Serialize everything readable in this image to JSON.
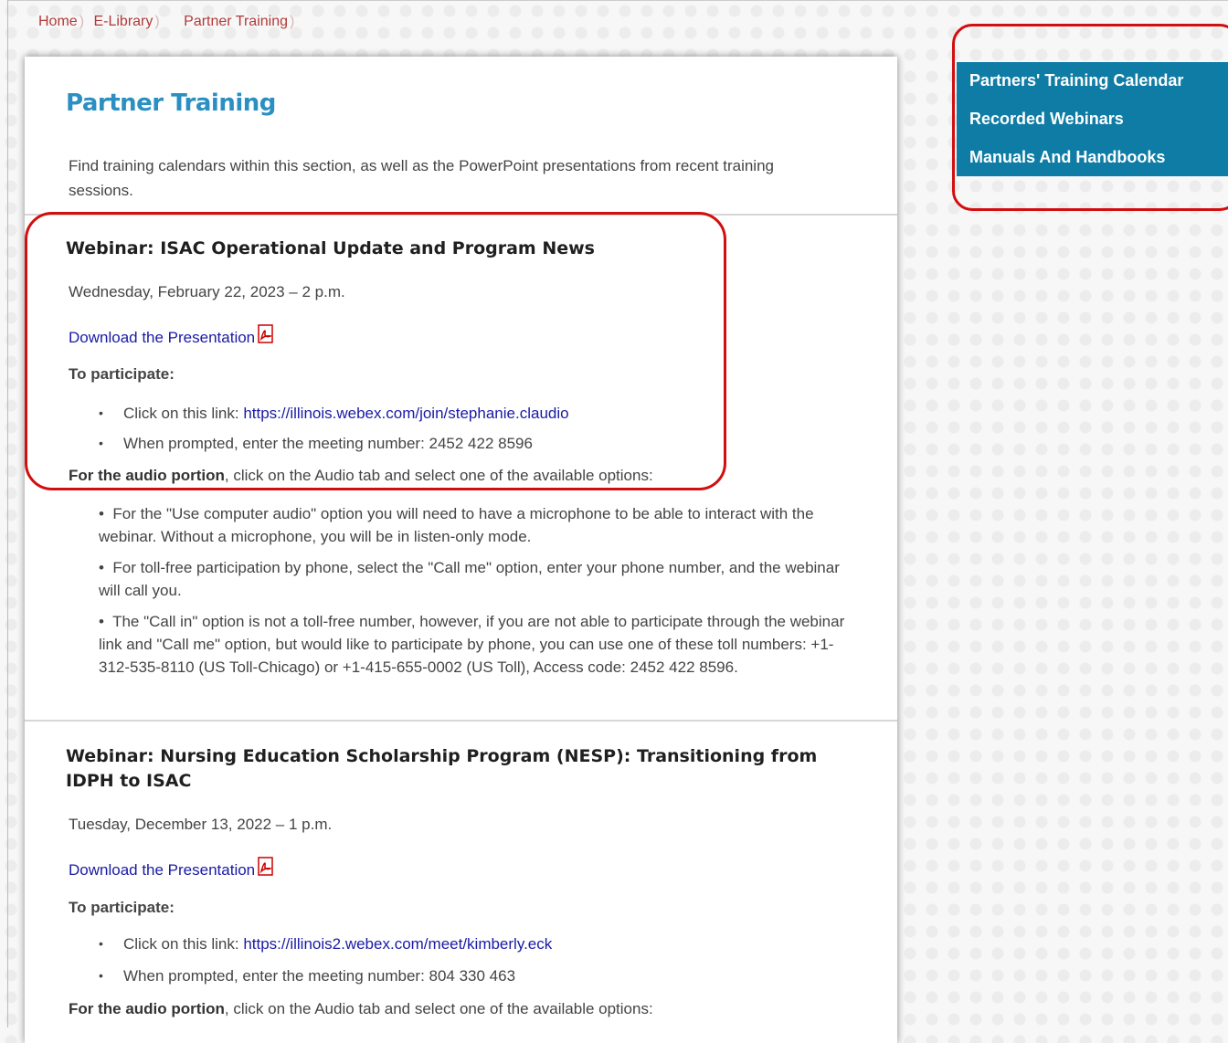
{
  "breadcrumb": [
    "Home",
    "E-Library",
    "Partner Training"
  ],
  "page_title": "Partner Training",
  "intro": "Find training calendars within this section, as well as the PowerPoint presentations from recent training sessions.",
  "sidebar": {
    "items": [
      "Partners' Training Calendar",
      "Recorded Webinars",
      "Manuals And Handbooks"
    ]
  },
  "webinars": [
    {
      "title": "Webinar: ISAC Operational Update and Program News",
      "date": "Wednesday, February 22, 2023 – 2 p.m.",
      "download_label": "Download the Presentation",
      "participate_label": "To participate:",
      "link_prefix": "Click on this link: ",
      "link_url": "https://illinois.webex.com/join/stephanie.claudio",
      "meeting": "When prompted, enter the meeting number: 2452 422 8596",
      "audio_bold": "For the audio portion",
      "audio_rest": ", click on the Audio tab and select one of the available options:",
      "options": [
        "For the \"Use computer audio\" option you will need to have a microphone to be able to interact with the webinar. Without a microphone, you will be in listen-only mode.",
        "For toll-free participation by phone, select the \"Call me\" option, enter your phone number, and the webinar will call you.",
        "The \"Call in\" option is not a toll-free number, however, if you are not able to participate through the webinar link and \"Call me\" option, but would like to participate by phone, you can use one of these toll numbers: +1-312-535-8110 (US Toll-Chicago) or +1-415-655-0002 (US Toll), Access code: 2452 422 8596."
      ]
    },
    {
      "title": "Webinar: Nursing Education Scholarship Program (NESP): Transitioning from IDPH to ISAC",
      "date": "Tuesday, December 13, 2022 – 1 p.m.",
      "download_label": "Download the Presentation",
      "participate_label": "To participate:",
      "link_prefix": "Click on this link: ",
      "link_url": "https://illinois2.webex.com/meet/kimberly.eck",
      "meeting": "When prompted, enter the meeting number: 804 330 463",
      "audio_bold": "For the audio portion",
      "audio_rest": ", click on the Audio tab and select one of the available options:"
    }
  ],
  "icons": {
    "pdf": "pdf-icon"
  },
  "colors": {
    "title_blue": "#2a8fc2",
    "sidebar_blue": "#0f7ca5",
    "link_blue": "#1a1aa6",
    "breadcrumb_red": "#b23a3a",
    "highlight_red": "#d20f0f"
  }
}
